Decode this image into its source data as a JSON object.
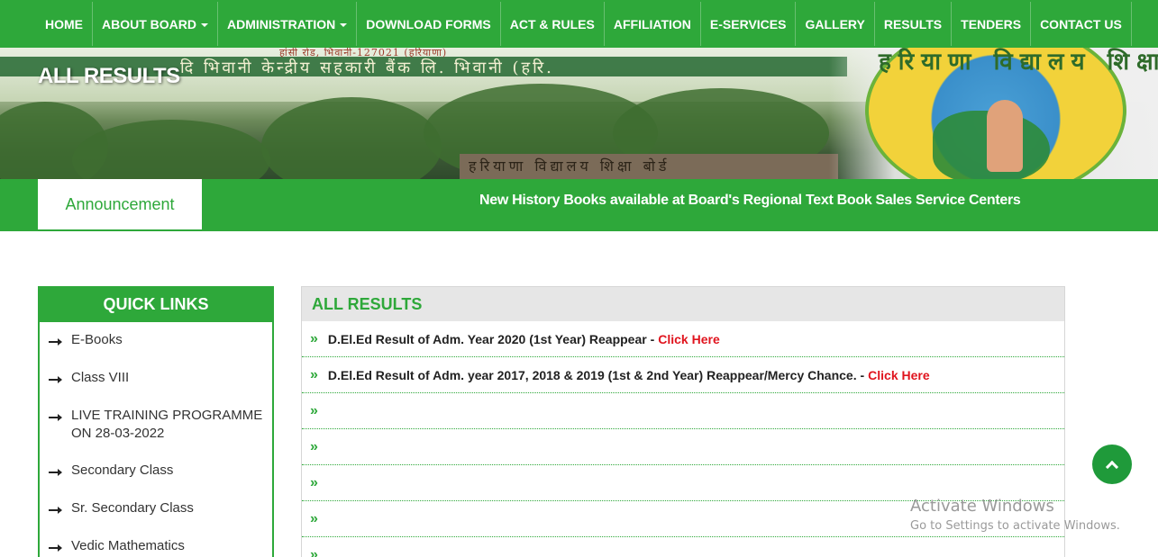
{
  "nav": {
    "items": [
      {
        "label": "HOME",
        "dropdown": false
      },
      {
        "label": "ABOUT BOARD",
        "dropdown": true
      },
      {
        "label": "ADMINISTRATION",
        "dropdown": true
      },
      {
        "label": "DOWNLOAD FORMS",
        "dropdown": false
      },
      {
        "label": "ACT & RULES",
        "dropdown": false
      },
      {
        "label": "AFFILIATION",
        "dropdown": false
      },
      {
        "label": "E-SERVICES",
        "dropdown": false
      },
      {
        "label": "GALLERY",
        "dropdown": false
      },
      {
        "label": "RESULTS",
        "dropdown": false
      },
      {
        "label": "TENDERS",
        "dropdown": false
      },
      {
        "label": "CONTACT US",
        "dropdown": false
      }
    ]
  },
  "banner": {
    "title": "ALL RESULTS",
    "arch_text": "दि भिवानी केन्द्रीय सहकारी बैंक लि. भिवानी (हरि.",
    "top_text": "हांसी रोड, भिवानी-127021 (हरियाणा)",
    "building_text": "हरियाणा विद्यालय शिक्षा बोर्ड",
    "seal_text": "हरियाणा विद्यालय शिक्षा बोर्ड"
  },
  "announcement": {
    "label": "Announcement",
    "text": "New History Books available at Board's Regional Text Book Sales Service Centers"
  },
  "quick_links": {
    "title": "QUICK LINKS",
    "items": [
      {
        "label": "E-Books"
      },
      {
        "label": "Class VIII"
      },
      {
        "label": "LIVE TRAINING PROGRAMME ON 28-03-2022"
      },
      {
        "label": "Secondary Class"
      },
      {
        "label": "Sr. Secondary Class"
      },
      {
        "label": "Vedic Mathematics"
      }
    ]
  },
  "results": {
    "title": "ALL RESULTS",
    "rows": [
      {
        "text": "D.El.Ed Result of Adm. Year 2020 (1st Year) Reappear - ",
        "link": "Click Here"
      },
      {
        "text": "D.El.Ed Result of Adm. year 2017, 2018 & 2019 (1st & 2nd Year) Reappear/Mercy Chance. -",
        "link": "Click Here"
      },
      {
        "text": "",
        "link": ""
      },
      {
        "text": "",
        "link": ""
      },
      {
        "text": "",
        "link": ""
      },
      {
        "text": "",
        "link": ""
      },
      {
        "text": "",
        "link": ""
      }
    ]
  },
  "watermark": {
    "title": "Activate Windows",
    "subtitle": "Go to Settings to activate Windows."
  },
  "colors": {
    "brand_green": "#2ea83a",
    "link_red": "#e0141e",
    "panel_header_bg": "#e6e6e6"
  },
  "icons": {
    "row_bullet": "double-chevron-right-icon",
    "quick_link_bullet": "long-arrow-right-icon",
    "scroll_top": "chevron-up-icon",
    "nav_caret": "caret-down-icon"
  }
}
